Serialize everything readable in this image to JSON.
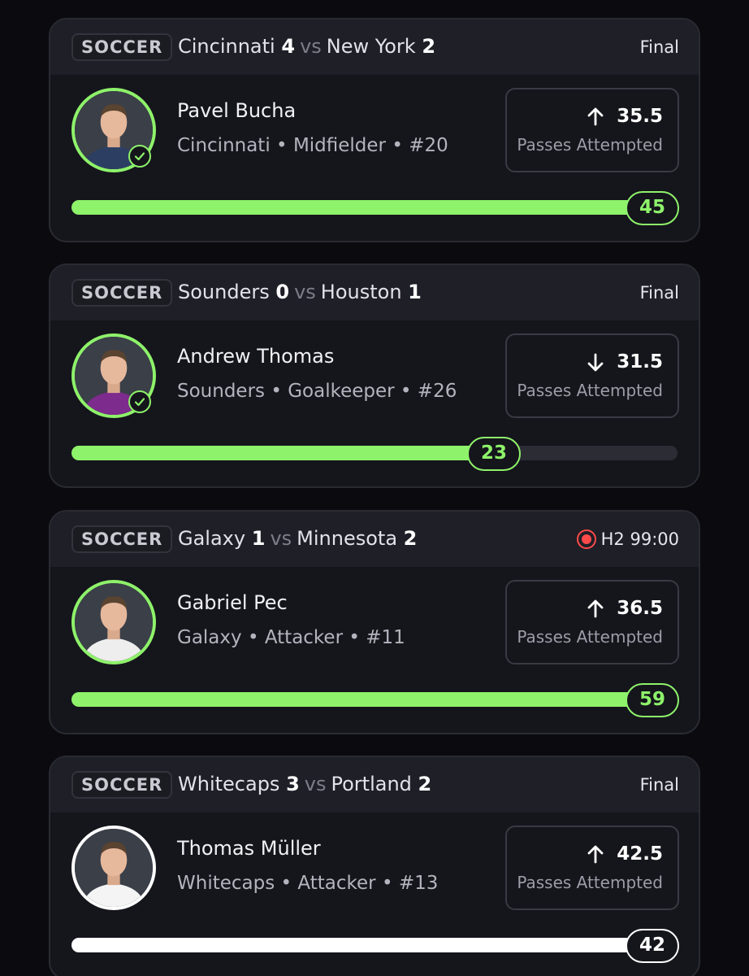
{
  "cards": [
    {
      "sport": "SOCCER",
      "home_team": "Cincinnati",
      "home_score": "4",
      "away_team": "New York",
      "away_score": "2",
      "vs": "vs",
      "status": "Final",
      "live": false,
      "player_name": "Pavel Bucha",
      "player_team": "Cincinnati",
      "player_position": "Midfielder",
      "player_number": "#20",
      "direction": "up",
      "line": "35.5",
      "stat": "Passes Attempted",
      "result": "45",
      "progress": 1.0,
      "accent": "#8ef26a",
      "settled_check": true,
      "jersey_color": "#2c3f63"
    },
    {
      "sport": "SOCCER",
      "home_team": "Sounders",
      "home_score": "0",
      "away_team": "Houston",
      "away_score": "1",
      "vs": "vs",
      "status": "Final",
      "live": false,
      "player_name": "Andrew Thomas",
      "player_team": "Sounders",
      "player_position": "Goalkeeper",
      "player_number": "#26",
      "direction": "down",
      "line": "31.5",
      "stat": "Passes Attempted",
      "result": "23",
      "progress": 0.73,
      "accent": "#8ef26a",
      "settled_check": true,
      "jersey_color": "#7d2b8c"
    },
    {
      "sport": "SOCCER",
      "home_team": "Galaxy",
      "home_score": "1",
      "away_team": "Minnesota",
      "away_score": "2",
      "vs": "vs",
      "status": "H2 99:00",
      "live": true,
      "player_name": "Gabriel Pec",
      "player_team": "Galaxy",
      "player_position": "Attacker",
      "player_number": "#11",
      "direction": "up",
      "line": "36.5",
      "stat": "Passes Attempted",
      "result": "59",
      "progress": 1.0,
      "accent": "#8ef26a",
      "settled_check": false,
      "jersey_color": "#eeeeee"
    },
    {
      "sport": "SOCCER",
      "home_team": "Whitecaps",
      "home_score": "3",
      "away_team": "Portland",
      "away_score": "2",
      "vs": "vs",
      "status": "Final",
      "live": false,
      "player_name": "Thomas Müller",
      "player_team": "Whitecaps",
      "player_position": "Attacker",
      "player_number": "#13",
      "direction": "up",
      "line": "42.5",
      "stat": "Passes Attempted",
      "result": "42",
      "progress": 1.0,
      "accent": "#ffffff",
      "settled_check": false,
      "jersey_color": "#f4f4f4"
    }
  ],
  "separator": "•"
}
